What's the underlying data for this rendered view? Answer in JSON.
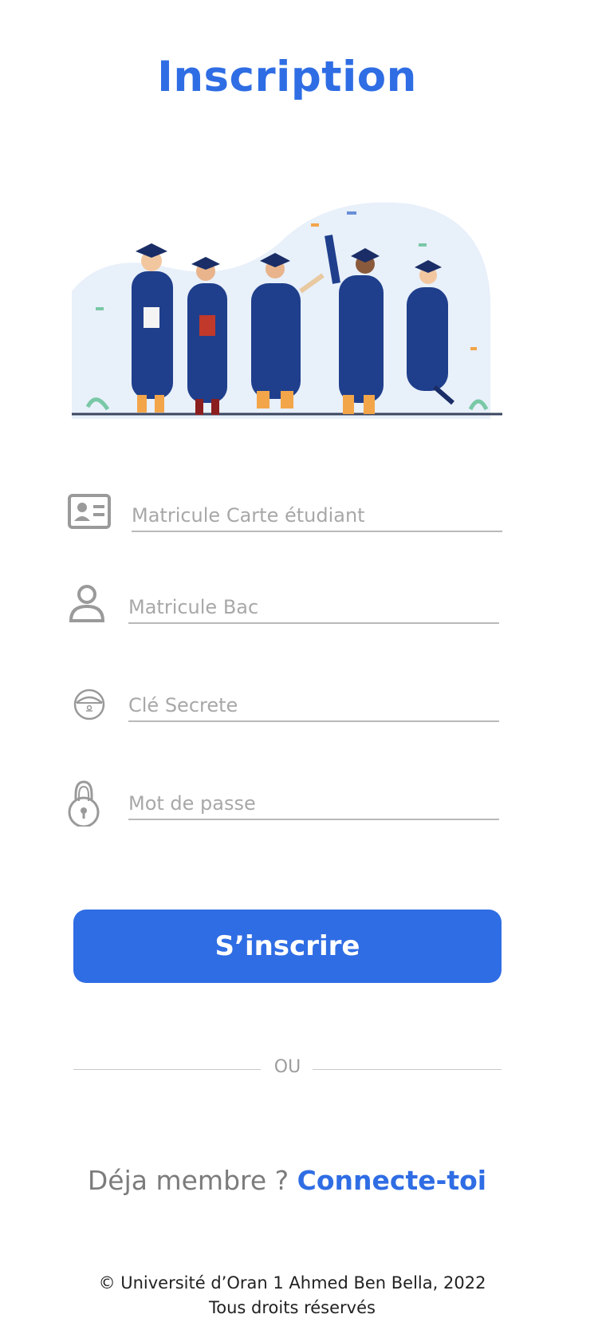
{
  "header": {
    "title": "Inscription"
  },
  "form": {
    "fields": [
      {
        "placeholder": "Matricule Carte étudiant",
        "icon": "id-card-icon"
      },
      {
        "placeholder": "Matricule Bac",
        "icon": "person-icon"
      },
      {
        "placeholder": "Clé Secrete",
        "icon": "secret-key-icon"
      },
      {
        "placeholder": "Mot de passe",
        "icon": "padlock-icon"
      }
    ],
    "submit_label": "S’inscrire"
  },
  "divider": {
    "text": "OU"
  },
  "login": {
    "question": "Déja membre ?",
    "link": "Connecte-toi"
  },
  "footer": {
    "line1": "© Université d’Oran 1 Ahmed Ben Bella, 2022",
    "line2": "Tous droits réservés"
  },
  "colors": {
    "accent": "#2f6de4",
    "placeholder": "#a8a8a8",
    "underline": "#b9b9b9"
  }
}
